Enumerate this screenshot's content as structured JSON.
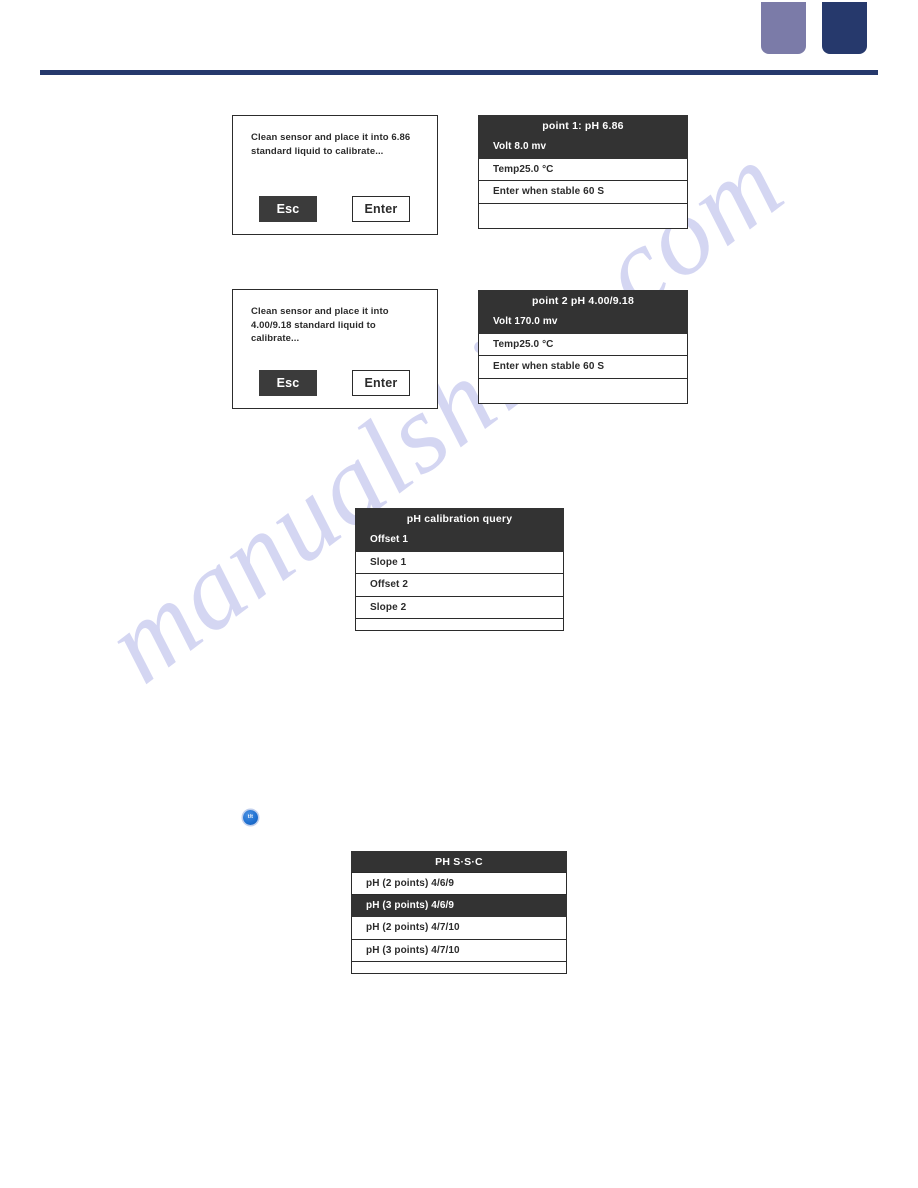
{
  "header": {
    "block_light_color": "#7b7ba8",
    "block_dark_color": "#26396c",
    "rule_color": "#26396c"
  },
  "watermark": {
    "text": "manualshive.com",
    "color": "#c9cbef",
    "badge_label": "t/t"
  },
  "screens": {
    "dialog_point1": {
      "message": "Clean sensor and place it into 6.86 standard liquid to calibrate...",
      "esc_label": "Esc",
      "enter_label": "Enter"
    },
    "panel_point1": {
      "title": "point 1: pH 6.86",
      "rows": [
        {
          "label": "Volt 8.0 mv",
          "selected": true
        },
        {
          "label": "Temp25.0 °C",
          "selected": false
        },
        {
          "label": "Enter when stable 60 S",
          "selected": false
        },
        {
          "label": "",
          "selected": false
        }
      ]
    },
    "dialog_point2": {
      "message": "Clean sensor and place it into 4.00/9.18 standard liquid to calibrate...",
      "esc_label": "Esc",
      "enter_label": "Enter"
    },
    "panel_point2": {
      "title": "point 2 pH 4.00/9.18",
      "rows": [
        {
          "label": "Volt 170.0 mv",
          "selected": true
        },
        {
          "label": "Temp25.0 °C",
          "selected": false
        },
        {
          "label": "Enter when stable 60 S",
          "selected": false
        },
        {
          "label": "",
          "selected": false
        }
      ]
    },
    "panel_calibration_query": {
      "title": "pH calibration query",
      "rows": [
        {
          "label": "Offset 1",
          "selected": true
        },
        {
          "label": "Slope 1",
          "selected": false
        },
        {
          "label": "Offset 2",
          "selected": false
        },
        {
          "label": "Slope 2",
          "selected": false
        },
        {
          "label": "",
          "selected": false
        }
      ]
    },
    "panel_ph_ssc": {
      "title": "PH S·S·C",
      "rows": [
        {
          "label": "pH (2 points) 4/6/9",
          "selected": false
        },
        {
          "label": "pH (3 points) 4/6/9",
          "selected": true
        },
        {
          "label": "pH (2 points) 4/7/10",
          "selected": false
        },
        {
          "label": "pH (3 points) 4/7/10",
          "selected": false
        },
        {
          "label": "",
          "selected": false
        }
      ]
    }
  }
}
